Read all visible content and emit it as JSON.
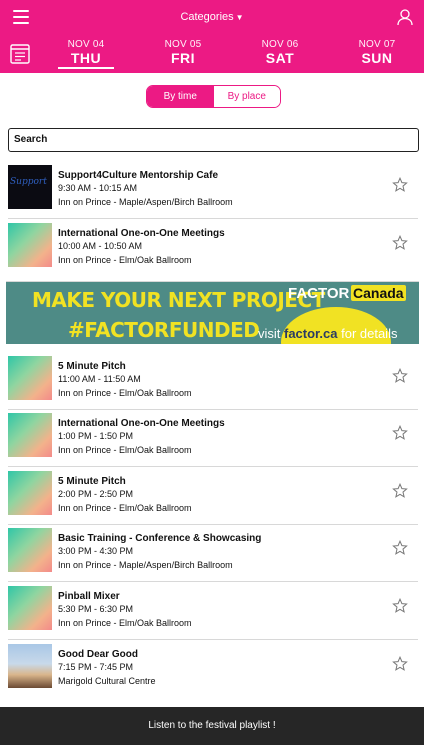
{
  "header": {
    "categories_label": "Categories",
    "menu_icon": "hamburger-menu-icon",
    "user_icon": "user-profile-icon",
    "calendar_icon": "calendar-list-icon",
    "accent": "#ec1a84"
  },
  "days": [
    {
      "month": "NOV 04",
      "weekday": "THU",
      "active": true
    },
    {
      "month": "NOV 05",
      "weekday": "FRI",
      "active": false
    },
    {
      "month": "NOV 06",
      "weekday": "SAT",
      "active": false
    },
    {
      "month": "NOV 07",
      "weekday": "SUN",
      "active": false
    }
  ],
  "view_toggle": {
    "by_time": "By time",
    "by_place": "By place",
    "selected": "By time"
  },
  "search": {
    "label": "Search"
  },
  "events": [
    {
      "title": "Support4Culture Mentorship Cafe",
      "time": "9:30 AM - 10:15 AM",
      "place": "Inn on Prince - Maple/Aspen/Birch Ballroom",
      "thumb_logo": "Support"
    },
    {
      "title": "International One-on-One Meetings",
      "time": "10:00 AM - 10:50 AM",
      "place": "Inn on Prince - Elm/Oak Ballroom"
    },
    {
      "title": "5 Minute Pitch",
      "time": "11:00 AM - 11:50 AM",
      "place": "Inn on Prince - Elm/Oak Ballroom"
    },
    {
      "title": "International One-on-One Meetings",
      "time": "1:00 PM - 1:50 PM",
      "place": "Inn on Prince - Elm/Oak Ballroom"
    },
    {
      "title": "5 Minute Pitch",
      "time": "2:00 PM - 2:50 PM",
      "place": "Inn on Prince - Elm/Oak Ballroom"
    },
    {
      "title": "Basic Training - Conference & Showcasing",
      "time": "3:00 PM - 4:30 PM",
      "place": "Inn on Prince - Maple/Aspen/Birch Ballroom"
    },
    {
      "title": "Pinball Mixer",
      "time": "5:30 PM - 6:30 PM",
      "place": "Inn on Prince - Elm/Oak Ballroom"
    },
    {
      "title": "Good Dear Good",
      "time": "7:15 PM - 7:45 PM",
      "place": "Marigold Cultural Centre"
    }
  ],
  "banner": {
    "line1": "MAKE YOUR NEXT PROJECT",
    "line2": "#FACTORFUNDED",
    "brand": "FACTOR",
    "flag": "Canada",
    "visit_prefix": "visit ",
    "visit_site": "factor.ca",
    "visit_suffix": " for details"
  },
  "footer": {
    "playlist_label": "Listen to the festival playlist !"
  }
}
